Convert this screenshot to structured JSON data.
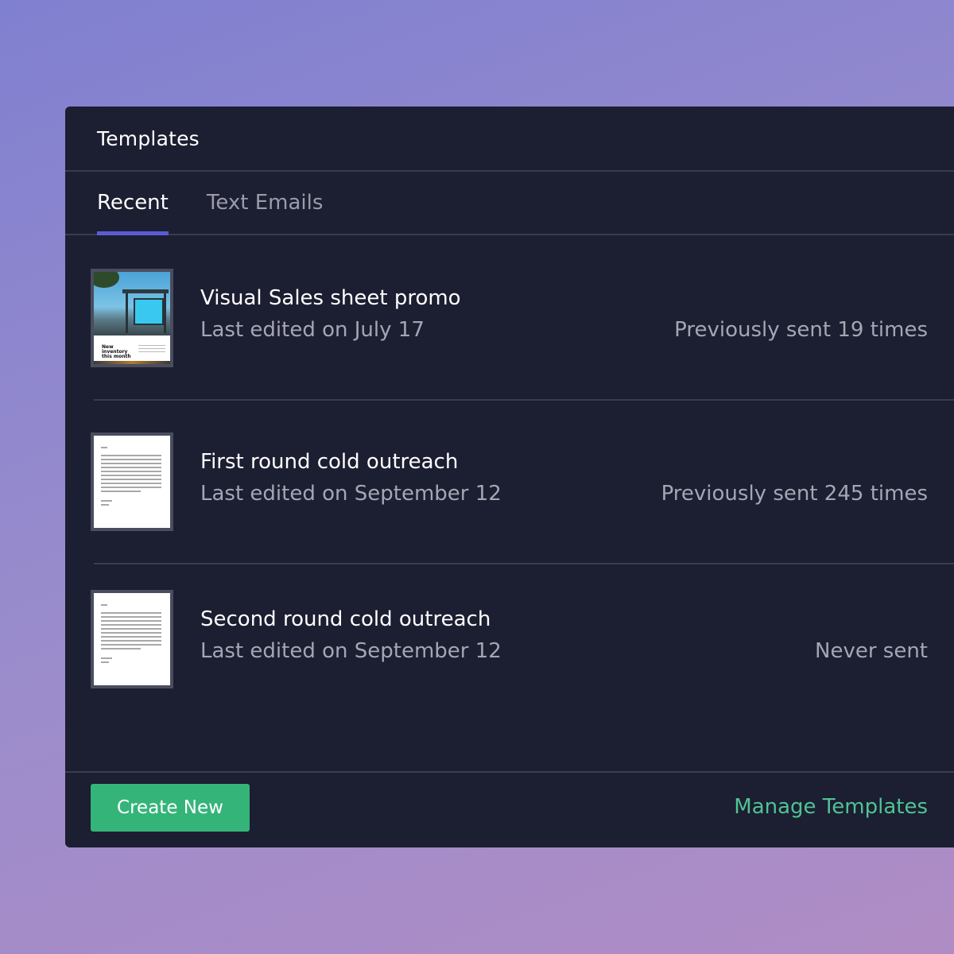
{
  "panel": {
    "title": "Templates"
  },
  "tabs": [
    {
      "label": "Recent",
      "active": true
    },
    {
      "label": "Text Emails",
      "active": false
    }
  ],
  "templates": [
    {
      "name": "Visual Sales sheet promo",
      "edited": "Last edited on July 17",
      "sent": "Previously sent 19 times",
      "thumbnail": "image",
      "thumbnail_caption": "New inventory this month"
    },
    {
      "name": "First round cold outreach",
      "edited": "Last edited on September 12",
      "sent": "Previously sent 245 times",
      "thumbnail": "document"
    },
    {
      "name": "Second round cold outreach",
      "edited": "Last edited on September 12",
      "sent": "Never sent",
      "thumbnail": "document"
    }
  ],
  "footer": {
    "create_label": "Create New",
    "manage_label": "Manage Templates"
  },
  "colors": {
    "panel_bg": "#1c1e31",
    "accent_tab": "#5b5bd6",
    "primary_button": "#35b47a",
    "link": "#4fc394"
  }
}
